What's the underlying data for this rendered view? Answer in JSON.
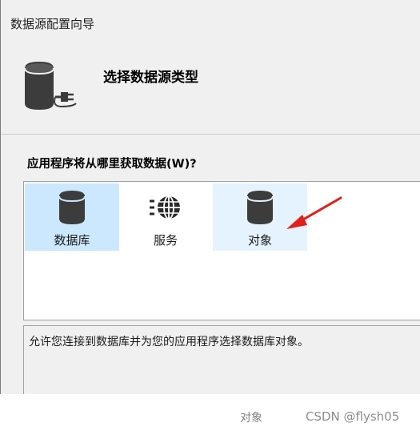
{
  "window": {
    "title": "数据源配置向导"
  },
  "header": {
    "title": "选择数据源类型",
    "icon": "database-plug-icon"
  },
  "question": {
    "label": "应用程序将从哪里获取数据(W)?"
  },
  "source_types": [
    {
      "label": "数据库",
      "icon": "database-icon",
      "state": "selected"
    },
    {
      "label": "服务",
      "icon": "service-globe-icon",
      "state": "normal"
    },
    {
      "label": "对象",
      "icon": "database-icon",
      "state": "hover"
    }
  ],
  "description": {
    "text": "允许您连接到数据库并为您的应用程序选择数据库对象。"
  },
  "annotation": {
    "arrow_color": "#e0201a"
  },
  "footer": {
    "caption": "对象",
    "watermark": "CSDN @flysh05"
  },
  "colors": {
    "selected": "#cce8ff",
    "hover": "#e5f3ff",
    "dialog_bg": "#f0f0f0",
    "icon_dark": "#3c3c3c"
  }
}
